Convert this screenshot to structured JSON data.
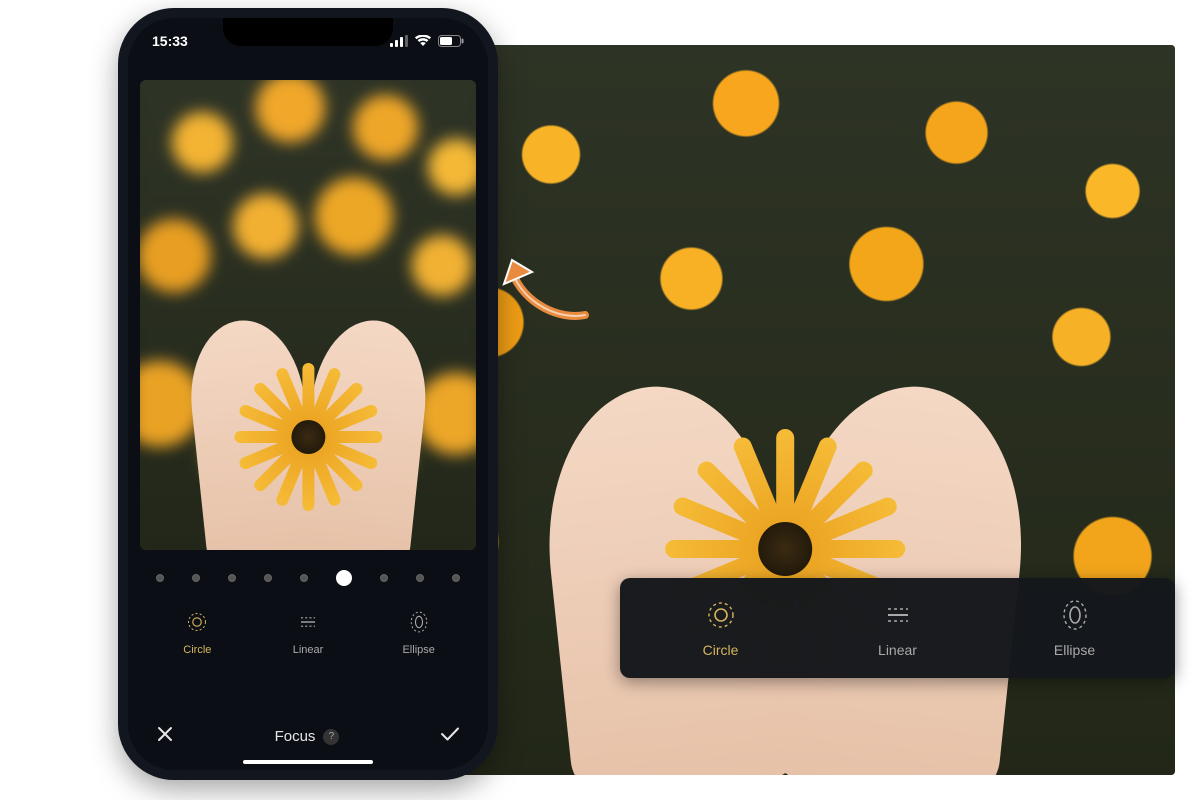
{
  "status_bar": {
    "time": "15:33"
  },
  "editor": {
    "slider_steps": 9,
    "slider_active_index": 5,
    "focus_types": [
      {
        "id": "circle",
        "label": "Circle",
        "icon": "circle-focus-icon",
        "selected": true
      },
      {
        "id": "linear",
        "label": "Linear",
        "icon": "linear-focus-icon",
        "selected": false
      },
      {
        "id": "ellipse",
        "label": "Ellipse",
        "icon": "ellipse-focus-icon",
        "selected": false
      }
    ],
    "tool_title": "Focus",
    "help_symbol": "?"
  },
  "colors": {
    "accent": "#d6b45e",
    "panel": "#14171c"
  }
}
